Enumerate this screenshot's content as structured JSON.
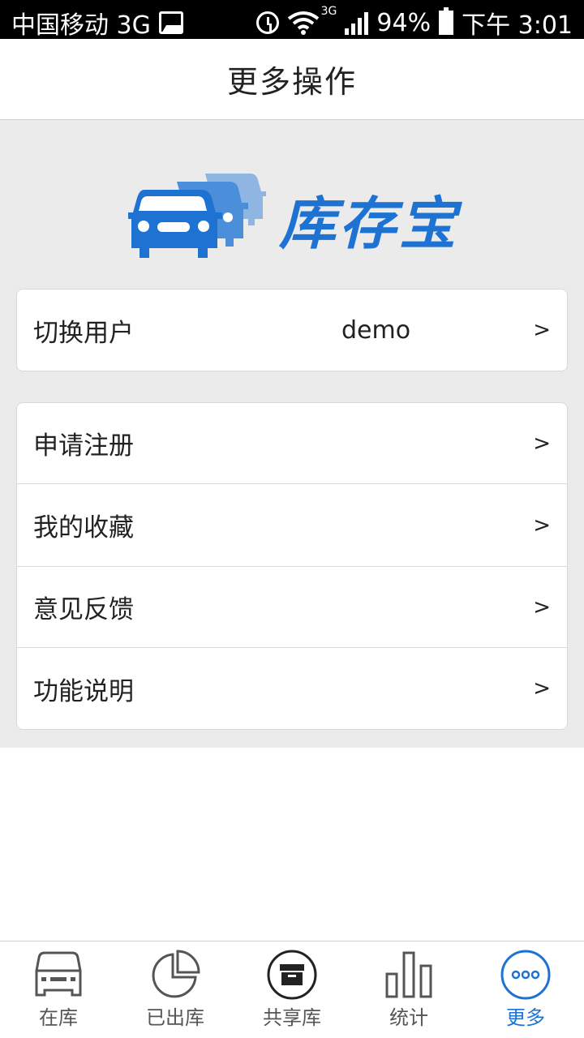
{
  "status_bar": {
    "carrier": "中国移动 3G",
    "network": "3G",
    "battery": "94%",
    "time": "下午 3:01"
  },
  "header": {
    "title": "更多操作"
  },
  "logo": {
    "text": "库存宝",
    "color": "#1e73d2"
  },
  "account": {
    "label": "切换用户",
    "value": "demo",
    "arrow": ">"
  },
  "menu": {
    "items": [
      {
        "label": "申请注册",
        "arrow": ">"
      },
      {
        "label": "我的收藏",
        "arrow": ">"
      },
      {
        "label": "意见反馈",
        "arrow": ">"
      },
      {
        "label": "功能说明",
        "arrow": ">"
      }
    ]
  },
  "bottom_nav": {
    "active_color": "#1e73d2",
    "items": [
      {
        "label": "在库",
        "icon": "car-icon"
      },
      {
        "label": "已出库",
        "icon": "pie-chart-icon"
      },
      {
        "label": "共享库",
        "icon": "box-icon"
      },
      {
        "label": "统计",
        "icon": "bar-chart-icon"
      },
      {
        "label": "更多",
        "icon": "more-icon"
      }
    ]
  }
}
